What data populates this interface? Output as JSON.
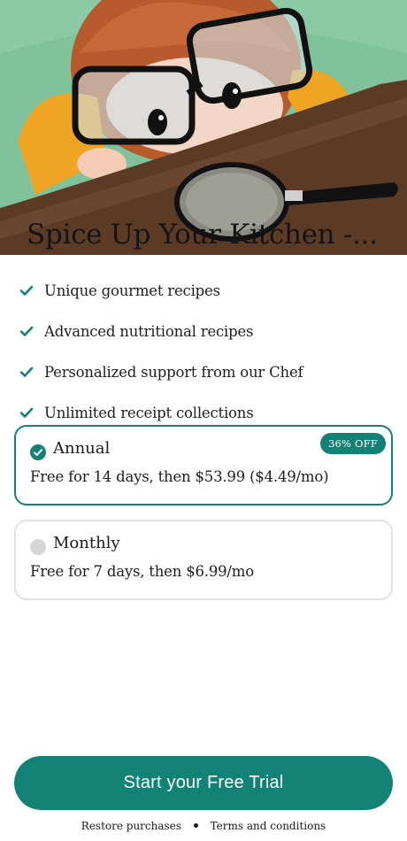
{
  "hero": {
    "title": "Spice Up Your Kitchen -...",
    "image_description_icon": "child-with-magnifying-glass-illustration"
  },
  "features": [
    {
      "label": "Unique gourmet recipes",
      "icon": "check-icon"
    },
    {
      "label": "Advanced nutritional recipes",
      "icon": "check-icon"
    },
    {
      "label": "Personalized support from our Chef",
      "icon": "check-icon"
    },
    {
      "label": "Unlimited receipt collections",
      "icon": "check-icon"
    }
  ],
  "plans": {
    "annual": {
      "name": "Annual",
      "description": "Free for 14 days, then $53.99 ($4.49/mo)",
      "badge": "36% OFF",
      "selected": true
    },
    "monthly": {
      "name": "Monthly",
      "description": "Free for 7 days, then $6.99/mo",
      "selected": false
    }
  },
  "cta": {
    "label": "Start your Free Trial"
  },
  "footer": {
    "restore": "Restore purchases",
    "terms": "Terms and conditions"
  },
  "colors": {
    "accent": "#128276",
    "border_inactive": "#e2e2e2",
    "radio_inactive": "#d6d6d6"
  }
}
